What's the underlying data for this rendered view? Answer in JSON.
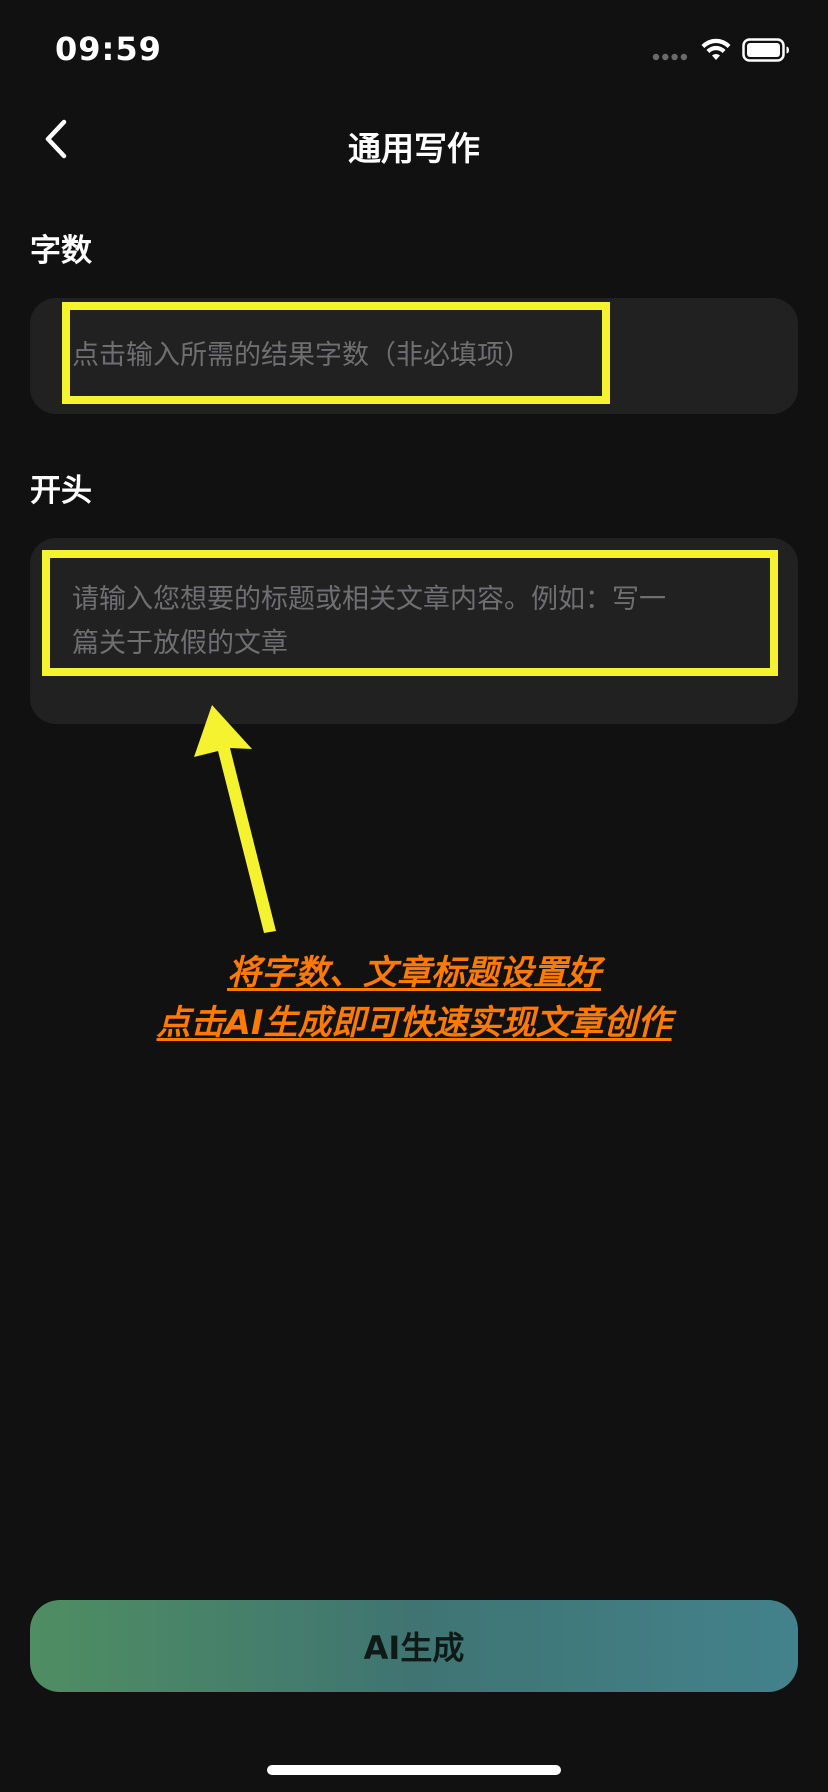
{
  "status_bar": {
    "time": "09:59"
  },
  "header": {
    "title": "通用写作"
  },
  "word_count_section": {
    "label": "字数",
    "placeholder": "点击输入所需的结果字数（非必填项）"
  },
  "opening_section": {
    "label": "开头",
    "placeholder_line1": "请输入您想要的标题或相关文章内容。例如：写一",
    "placeholder_line2": "篇关于放假的文章"
  },
  "annotation": {
    "line1": "将字数、文章标题设置好",
    "line2": "点击AI生成即可快速实现文章创作"
  },
  "generate_button": {
    "label": "AI生成"
  },
  "colors": {
    "background": "#111111",
    "input_background": "#212121",
    "highlight": "#f5f230",
    "annotation": "#ff7a00",
    "button_gradient_start": "#4f8e62",
    "button_gradient_end": "#43828c"
  },
  "icons": [
    "signal-dots-icon",
    "wifi-icon",
    "battery-icon",
    "back-chevron-icon",
    "arrow-up-icon"
  ]
}
